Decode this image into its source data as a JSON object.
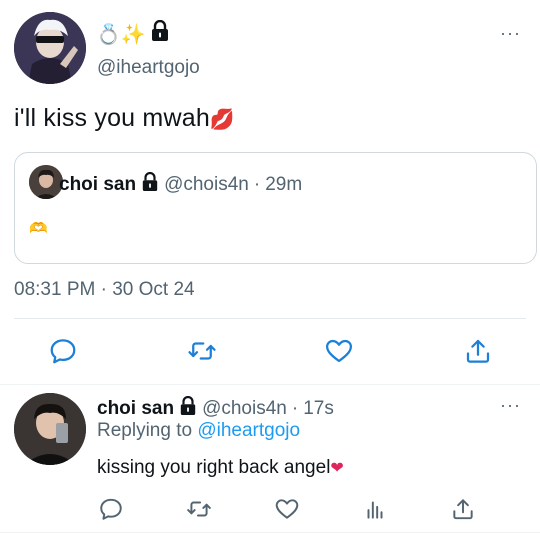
{
  "main_tweet": {
    "name_emojis": "💍✨",
    "handle": "@iheartgojo",
    "text": "i'll kiss you mwah",
    "text_emoji": "💋",
    "timestamp": "08:31 PM · 30 Oct 24",
    "quote": {
      "name": "choi san",
      "handle": "@chois4n",
      "separator": "·",
      "time": "29m",
      "body": "🫶"
    }
  },
  "reply": {
    "name": "choi san",
    "handle": "@chois4n",
    "separator": "·",
    "time": "17s",
    "replying_prefix": "Replying to",
    "replying_to": "@iheartgojo",
    "text": "kissing you right back angel",
    "text_emoji": "❤"
  },
  "icons": {
    "more": "···",
    "actions": [
      "reply-icon",
      "retweet-icon",
      "like-icon",
      "share-icon"
    ],
    "reply_actions": [
      "reply-icon",
      "retweet-icon",
      "like-icon",
      "analytics-icon",
      "share-icon"
    ]
  },
  "colors": {
    "text": "#0f1419",
    "secondary": "#536471",
    "link": "#1d9bf0",
    "border": "#cfd9de"
  }
}
